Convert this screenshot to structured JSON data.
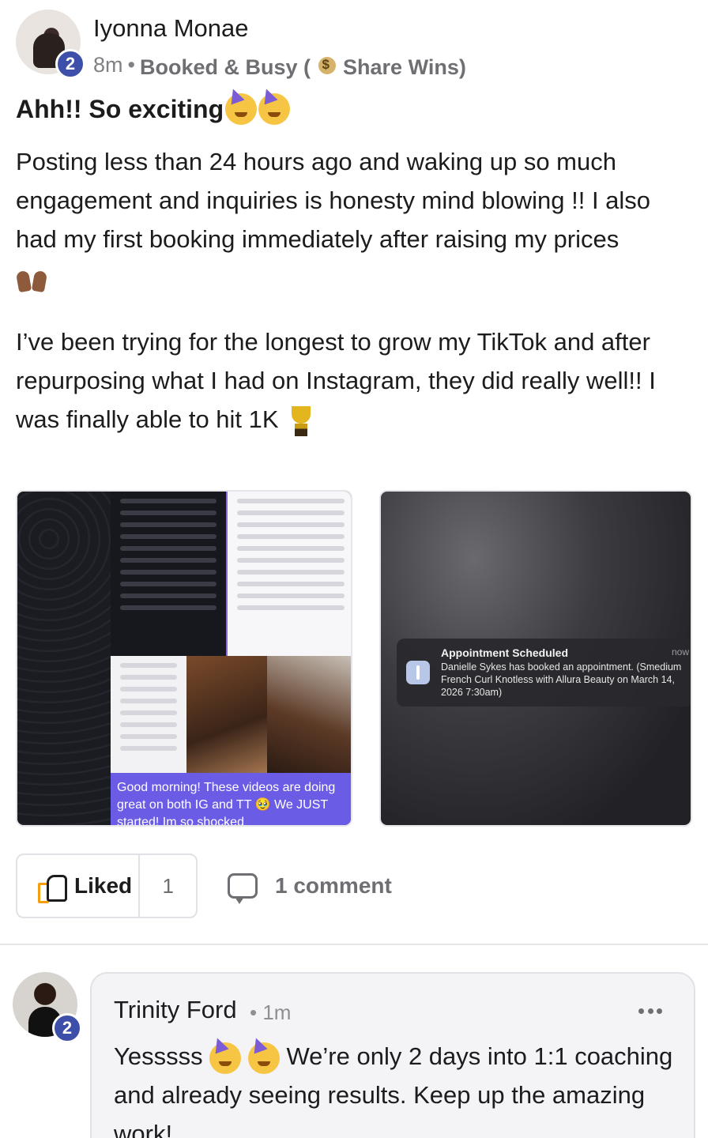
{
  "post": {
    "author": {
      "name": "Iyonna Monae",
      "level": "2"
    },
    "time": "8m",
    "separator": "•",
    "space_name": "Booked & Busy (",
    "space_suffix": "Share Wins)",
    "title": "Ahh!! So exciting",
    "body": {
      "para1": "Posting less than 24 hours ago and waking up so much engagement and inquiries is honesty mind blowing !! I also had my first booking immediately after raising my prices",
      "para2": "I’ve been trying for the longest to grow my TikTok and after repurposing what I had on Instagram, they did really well!! I was finally able to hit 1K"
    },
    "icons": {
      "space": "money-bag-icon",
      "title": "partying-face-icon",
      "para1": "raised-hands-icon",
      "para2": "trophy-icon"
    },
    "media": [
      {
        "caption": "Good morning! These videos are doing great on both IG and TT 🥹 We JUST started! Im so shocked"
      },
      {
        "notification": {
          "title": "Appointment Scheduled",
          "time": "now",
          "text": "Danielle Sykes has booked an appointment. (Smedium French Curl Knotless with Allura Beauty on March 14, 2026 7:30am)"
        }
      }
    ],
    "actions": {
      "like_label": "Liked",
      "like_count": "1",
      "comment_label": "1 comment"
    }
  },
  "comment": {
    "author": {
      "name": "Trinity Ford",
      "level": "2"
    },
    "separator": "•",
    "time": "1m",
    "text_start": "Yesssss",
    "text_rest": " We’re only 2 days into 1:1 coaching and already seeing results. Keep up the amazing work!"
  },
  "colors": {
    "badge": "#3d4fa8",
    "caption_bg": "#6b5ce6",
    "muted_text": "#808086"
  }
}
